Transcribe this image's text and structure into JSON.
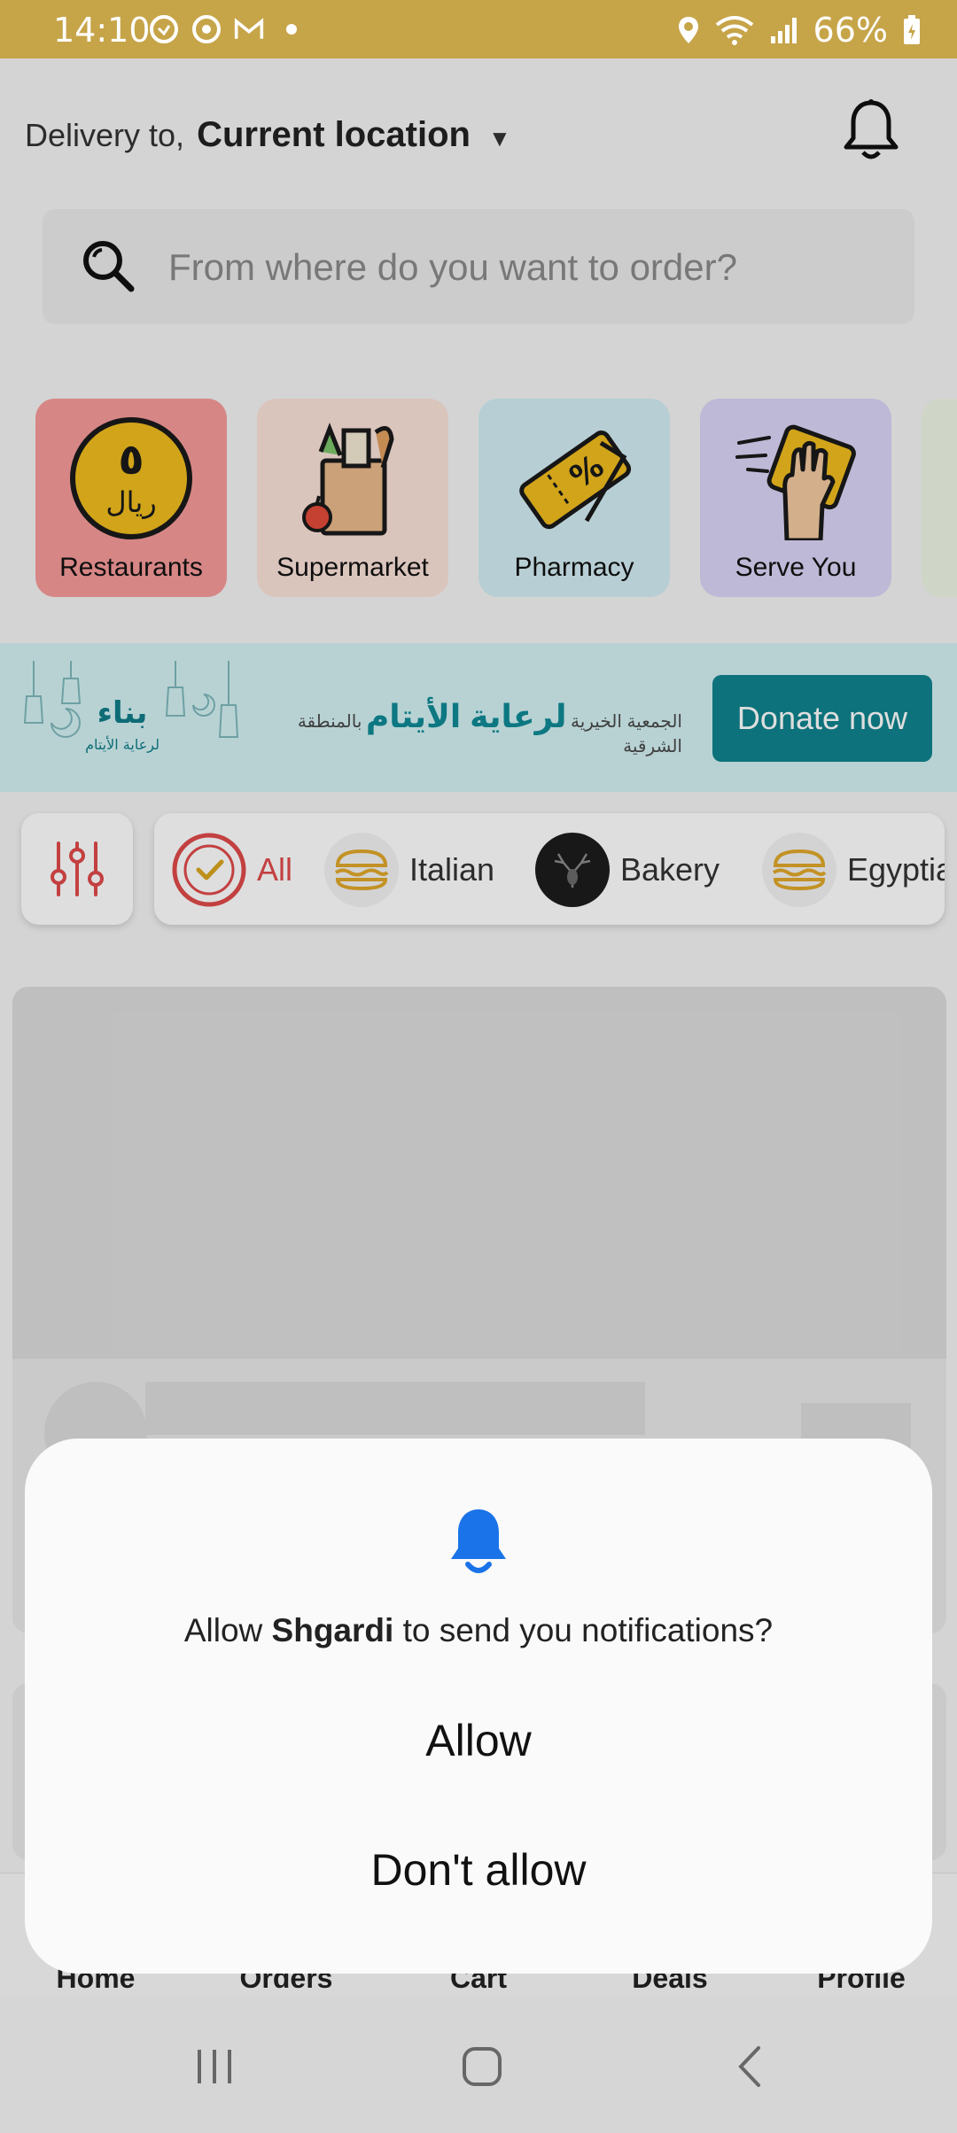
{
  "status_bar": {
    "time": "14:10",
    "battery": "66%"
  },
  "header": {
    "delivery_label": "Delivery to,",
    "location": "Current location"
  },
  "search": {
    "placeholder": "From where do you want to order?"
  },
  "categories": [
    {
      "label": "Restaurants",
      "bg": "#f79a9a"
    },
    {
      "label": "Supermarket",
      "bg": "#fbe3d9"
    },
    {
      "label": "Pharmacy",
      "bg": "#d3eef4"
    },
    {
      "label": "Serve You",
      "bg": "#d9d5f6"
    }
  ],
  "banner": {
    "logo_ar": "بناء",
    "logo_sub_ar": "لرعاية الأيتام",
    "org_prefix_ar": "الجمعية الخيرية",
    "org_main_ar": "لرعاية الأيتام",
    "org_suffix_ar": "بالمنطقة الشرقية",
    "donate_label": "Donate now"
  },
  "filters": [
    {
      "label": "All",
      "active": true
    },
    {
      "label": "Italian"
    },
    {
      "label": "Bakery"
    },
    {
      "label": "Egyptian"
    }
  ],
  "bottom_nav": [
    "Home",
    "Orders",
    "Cart",
    "Deals",
    "Profile"
  ],
  "dialog": {
    "message_prefix": "Allow",
    "app_name": "Shgardi",
    "message_suffix": "to send you notifications?",
    "allow_label": "Allow",
    "deny_label": "Don't allow"
  },
  "colors": {
    "status_bar": "#c6a448",
    "accent_red": "#e04a4a",
    "teal": "#10848e",
    "dialog_bell": "#1a73e8"
  }
}
